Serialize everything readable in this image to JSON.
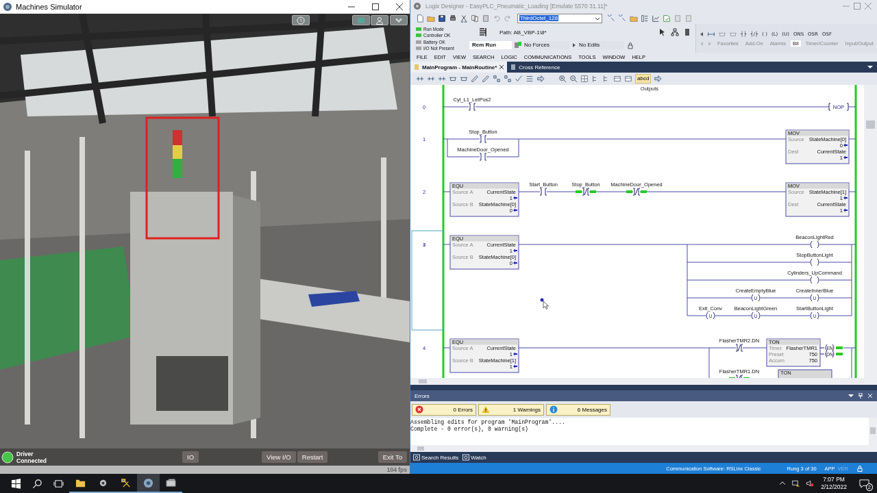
{
  "simulator": {
    "title": "Machines Simulator",
    "scene": {
      "kind": "picture"
    },
    "driver": {
      "label": "Driver Connected",
      "connected": true
    },
    "buttons": [
      "IO",
      "View I/O",
      "Restart",
      "Exit To"
    ],
    "fps": "104 fps"
  },
  "logix": {
    "title": "Logix Designer - EasyPLC_Pneumatic_Loading [Emulate 5570 31.11]*",
    "tag_combo": {
      "value": "ThirdOctet_128"
    },
    "status_lights": [
      {
        "label": "Run Mode",
        "on": true
      },
      {
        "label": "Controller OK",
        "on": true
      },
      {
        "label": "Battery OK",
        "on": false
      },
      {
        "label": "I/O Not Present",
        "on": false
      }
    ],
    "path": "Path: AB_VBP-1\\8*",
    "mode": "Rem Run",
    "forces": "No Forces",
    "edits": "No Edits",
    "instructions": [
      "┤├",
      "┤/├",
      "( )",
      "(L)",
      "(U)",
      "ONS",
      "OSR",
      "OSF"
    ],
    "palette_tabs": [
      {
        "label": "Favorites",
        "selected": false
      },
      {
        "label": "Add-On",
        "selected": false
      },
      {
        "label": "Alarms",
        "selected": false
      },
      {
        "label": "Bit",
        "selected": true
      },
      {
        "label": "Timer/Counter",
        "selected": false
      },
      {
        "label": "Input/Output",
        "selected": false
      }
    ],
    "menu": [
      "FILE",
      "EDIT",
      "VIEW",
      "SEARCH",
      "LOGIC",
      "COMMUNICATIONS",
      "TOOLS",
      "WINDOW",
      "HELP"
    ],
    "doc_tabs": [
      {
        "label": "MainProgram - MainRoutine*",
        "selected": true
      },
      {
        "label": "Cross Reference",
        "selected": false
      }
    ],
    "text_tool": "abcd",
    "ladder": {
      "rungs": [
        {
          "number": "0",
          "selected": false,
          "title": "Outputs",
          "inputs": [
            {
              "kind": "xic",
              "tag": "Cyl_L1_LetPos2",
              "energized": false
            }
          ],
          "outputs": [
            {
              "kind": "nop",
              "name": "NOP"
            }
          ]
        },
        {
          "number": "1",
          "selected": false,
          "inputs": [
            {
              "rows": [
                [
                  {
                    "kind": "xic",
                    "tag": "Stop_Button",
                    "energized": false
                  }
                ],
                [
                  {
                    "kind": "xic",
                    "tag": "MachineDoor_Opened",
                    "energized": false
                  }
                ]
              ]
            }
          ],
          "outputs": [
            {
              "kind": "mov",
              "name": "MOV",
              "fields": [
                {
                  "label": "Source",
                  "value": "StateMachine[0]",
                  "reading": "0"
                },
                {
                  "label": "Dest",
                  "value": "CurrentState",
                  "reading": "1"
                }
              ]
            }
          ]
        },
        {
          "number": "2",
          "selected": false,
          "inputs": [
            {
              "kind": "equ",
              "name": "EQU",
              "fields": [
                {
                  "label": "Source A",
                  "value": "CurrentState",
                  "reading": "1"
                },
                {
                  "label": "Source B",
                  "value": "StateMachine[0]",
                  "reading": "0"
                }
              ]
            },
            {
              "kind": "xic",
              "tag": "Start_Button",
              "energized": false
            },
            {
              "kind": "xio",
              "tag": "Stop_Button",
              "energized": true
            },
            {
              "kind": "xio",
              "tag": "MachineDoor_Opened",
              "energized": true
            }
          ],
          "outputs": [
            {
              "kind": "mov",
              "name": "MOV",
              "fields": [
                {
                  "label": "Source",
                  "value": "StateMachine[1]",
                  "reading": "1"
                },
                {
                  "label": "Dest",
                  "value": "CurrentState",
                  "reading": "1"
                }
              ]
            }
          ]
        },
        {
          "number": "3",
          "selected": true,
          "inputs": [
            {
              "kind": "equ",
              "name": "EQU",
              "fields": [
                {
                  "label": "Source A",
                  "value": "CurrentState",
                  "reading": "1"
                },
                {
                  "label": "Source B",
                  "value": "StateMachine[0]",
                  "reading": "0"
                }
              ]
            }
          ],
          "outputs": [
            {
              "rows": [
                [
                  "",
                  "",
                  {
                    "kind": "coil",
                    "tag": "BeaconLightRed",
                    "energized": false
                  }
                ],
                [
                  "",
                  "",
                  {
                    "kind": "coil",
                    "tag": "StopButtonLight",
                    "energized": false
                  }
                ],
                [
                  "",
                  "",
                  {
                    "kind": "coil",
                    "tag": "Cylinders_UpCommand",
                    "energized": false
                  }
                ],
                [
                  "",
                  {
                    "kind": "coil",
                    "tag": "CreateEmptyBlue",
                    "mark": "U",
                    "energized": false
                  },
                  {
                    "kind": "coil",
                    "tag": "CreateInnerBlue",
                    "mark": "U",
                    "energized": false
                  }
                ],
                [
                  {
                    "kind": "coil",
                    "tag": "Exit_Conv",
                    "mark": "U",
                    "energized": false
                  },
                  {
                    "kind": "coil",
                    "tag": "BeaconLightGreen",
                    "mark": "U",
                    "energized": false
                  },
                  {
                    "kind": "coil",
                    "tag": "StartButtonLight",
                    "mark": "U",
                    "energized": false
                  }
                ]
              ]
            }
          ]
        },
        {
          "number": "4",
          "selected": false,
          "inputs": [
            {
              "kind": "equ",
              "name": "EQU",
              "fields": [
                {
                  "label": "Source A",
                  "value": "CurrentState",
                  "reading": "1"
                },
                {
                  "label": "Source B",
                  "value": "StateMachine[1]",
                  "reading": "1"
                }
              ]
            }
          ],
          "outputs": [
            {
              "rows": [
                [
                  {
                    "kind": "xio",
                    "tag": "FlasherTMR2.DN",
                    "energized": false
                  },
                  {
                    "kind": "ton",
                    "name": "TON",
                    "fields": [
                      {
                        "label": "Timer",
                        "value": "FlasherTMR1"
                      },
                      {
                        "label": "Preset",
                        "value": "750"
                      },
                      {
                        "label": "Accum",
                        "value": "750"
                      }
                    ],
                    "bits": [
                      {
                        "label": "EN",
                        "on": true
                      },
                      {
                        "label": "DN",
                        "on": true
                      }
                    ]
                  }
                ],
                [
                  {
                    "kind": "xio",
                    "tag": "FlasherTMR1.DN",
                    "energized": true
                  },
                  {
                    "kind": "ton",
                    "name": "TON"
                  }
                ]
              ]
            }
          ]
        }
      ]
    },
    "errors": {
      "title": "Errors",
      "filters": [
        {
          "kind": "error",
          "label": "0 Errors"
        },
        {
          "kind": "warning",
          "label": "1 Warnings"
        },
        {
          "kind": "info",
          "label": "6 Messages"
        }
      ],
      "lines": [
        "Assembling edits for program 'MainProgram'....",
        "Complete - 0 error(s), 0 warning(s)"
      ]
    },
    "bottom_tabs": [
      "Search Results",
      "Watch"
    ],
    "status_bar": {
      "communication": "Communication Software: RSLinx Classic",
      "rung": "Rung 3 of 30",
      "app": "APP",
      "ver": "VER"
    }
  },
  "taskbar": {
    "apps": [
      {
        "selected": false
      },
      {
        "selected": false
      },
      {
        "selected": false
      },
      {
        "selected": true
      },
      {
        "selected": false
      }
    ],
    "time": "7:07 PM",
    "date": "2/12/2022",
    "notifications": "2"
  }
}
